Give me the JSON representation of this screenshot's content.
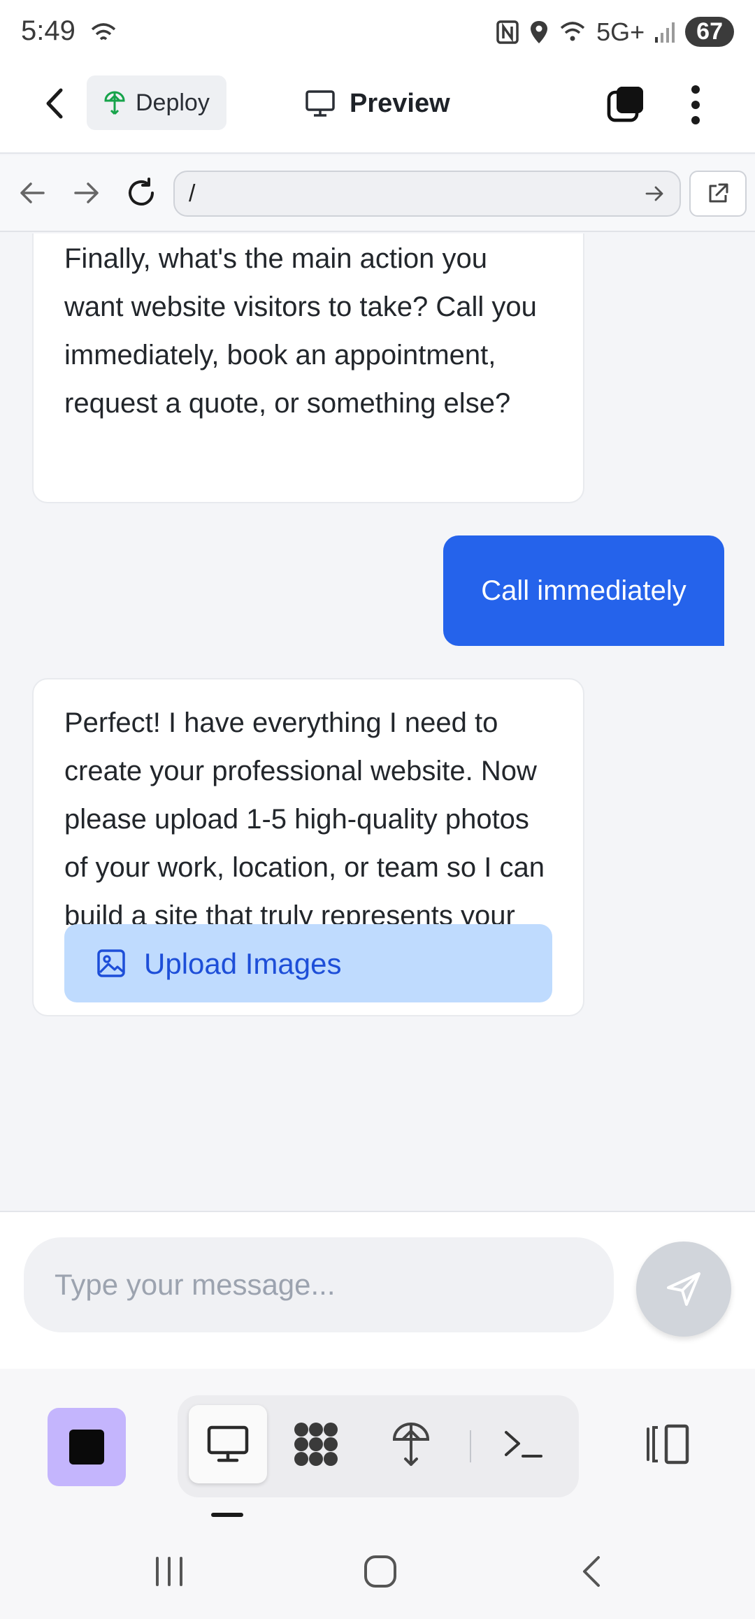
{
  "status_bar": {
    "time": "5:49",
    "network": "5G+",
    "battery": "67"
  },
  "header": {
    "deploy_label": "Deploy",
    "preview_label": "Preview"
  },
  "browser": {
    "url": "/"
  },
  "chat": {
    "messages": [
      {
        "role": "assistant",
        "text": "Finally, what's the main action you want website visitors to take? Call you immediately, book an appointment, request a quote, or something else?"
      },
      {
        "role": "user",
        "text": "Call immediately"
      },
      {
        "role": "assistant",
        "text": "Perfect! I have everything I need to create your professional website. Now please upload 1-5 high-quality photos of your work, location, or team so I can build a site that truly represents your business."
      }
    ],
    "upload_button_label": "Upload Images"
  },
  "composer": {
    "placeholder": "Type your message..."
  },
  "toolbar": {
    "items": [
      "stop-icon",
      "desktop-icon",
      "grid-icon",
      "deploy-icon",
      "terminal-icon",
      "panel-toggle-icon"
    ]
  },
  "colors": {
    "accent": "#2563eb",
    "upload_bg": "#bfdbfe",
    "stop_bg": "#c4b5fd"
  }
}
